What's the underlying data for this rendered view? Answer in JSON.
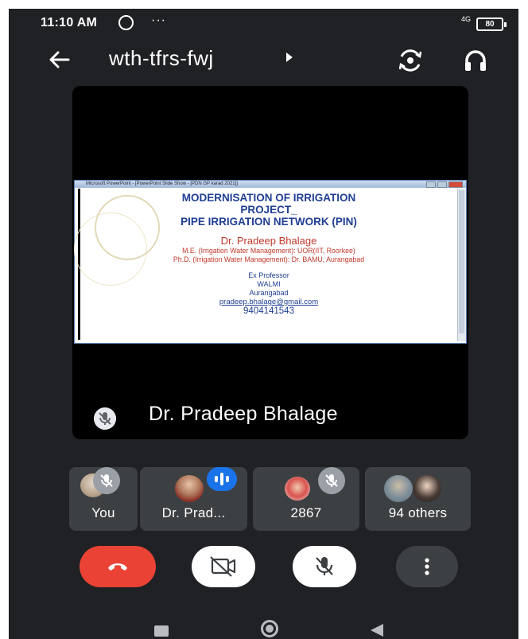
{
  "status_bar": {
    "time": "11:10 AM",
    "dots": "···",
    "network": "4G",
    "battery": "80"
  },
  "header": {
    "meeting_code": "wth-tfrs-fwj"
  },
  "presentation": {
    "window_title": "Microsoft PowerPoint - [PowerPoint Slide Show - [PDN GP karad 2021]]",
    "slide": {
      "title_line1": "MODERNISATION OF IRRIGATION",
      "title_line2": "PROJECT_",
      "title_line3": "PIPE IRRIGATION NETWORK (PIN)",
      "author": "Dr. Pradeep Bhalage",
      "credential1": "M.E. (Irrigation Water Management): UOR(IIT, Roorkee)",
      "credential2": "Ph.D. (Irrigation Water Management): Dr. BAMU, Aurangabad",
      "role": "Ex Professor",
      "org": "WALMI",
      "city": "Aurangabad",
      "email": "pradeep.bhalage@gmail.com",
      "phone": "9404141543"
    }
  },
  "main_speaker": {
    "name": "Dr. Pradeep Bhalage",
    "muted": true
  },
  "participants": [
    {
      "label": "You",
      "muted": true
    },
    {
      "label": "Dr. Prad...",
      "speaking": true
    },
    {
      "label": "2867",
      "muted": true
    },
    {
      "label": "94 others"
    }
  ],
  "controls": {
    "end_call_icon": "phone-hangup-icon",
    "camera_icon": "video-off-icon",
    "mic_icon": "mic-off-icon",
    "more_icon": "more-vert-icon"
  },
  "colors": {
    "background": "#202124",
    "tile": "#3c4043",
    "end_call": "#ea4335",
    "speaking": "#1a73e8",
    "slide_title": "#1f3f93",
    "slide_author": "#c0392b"
  }
}
